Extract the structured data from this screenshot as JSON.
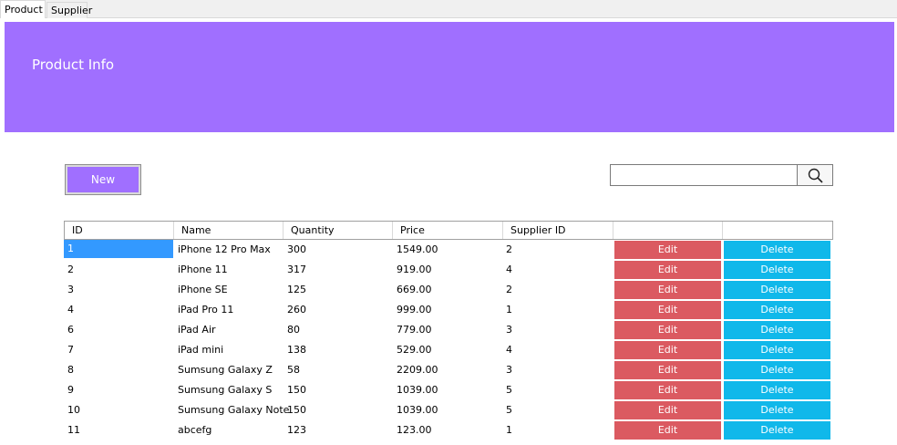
{
  "tabs": [
    {
      "label": "Product",
      "active": true
    },
    {
      "label": "Supplier",
      "active": false
    }
  ],
  "header": {
    "title": "Product Info",
    "color": "#a06fff"
  },
  "toolbar": {
    "new_label": "New",
    "search_value": ""
  },
  "table": {
    "columns": [
      "ID",
      "Name",
      "Quantity",
      "Price",
      "Supplier ID",
      "",
      ""
    ],
    "rows": [
      {
        "id": "1",
        "name": "iPhone 12 Pro Max",
        "quantity": "300",
        "price": "1549.00",
        "supplier_id": "2",
        "edit": "Edit",
        "delete": "Delete"
      },
      {
        "id": "2",
        "name": "iPhone 11",
        "quantity": "317",
        "price": "919.00",
        "supplier_id": "4",
        "edit": "Edit",
        "delete": "Delete"
      },
      {
        "id": "3",
        "name": "iPhone SE",
        "quantity": "125",
        "price": "669.00",
        "supplier_id": "2",
        "edit": "Edit",
        "delete": "Delete"
      },
      {
        "id": "4",
        "name": "iPad Pro 11",
        "quantity": "260",
        "price": "999.00",
        "supplier_id": "1",
        "edit": "Edit",
        "delete": "Delete"
      },
      {
        "id": "6",
        "name": "iPad Air",
        "quantity": "80",
        "price": "779.00",
        "supplier_id": "3",
        "edit": "Edit",
        "delete": "Delete"
      },
      {
        "id": "7",
        "name": "iPad mini",
        "quantity": "138",
        "price": "529.00",
        "supplier_id": "4",
        "edit": "Edit",
        "delete": "Delete"
      },
      {
        "id": "8",
        "name": "Sumsung Galaxy Z",
        "quantity": "58",
        "price": "2209.00",
        "supplier_id": "3",
        "edit": "Edit",
        "delete": "Delete"
      },
      {
        "id": "9",
        "name": "Sumsung Galaxy S",
        "quantity": "150",
        "price": "1039.00",
        "supplier_id": "5",
        "edit": "Edit",
        "delete": "Delete"
      },
      {
        "id": "10",
        "name": "Sumsung Galaxy Note",
        "quantity": "150",
        "price": "1039.00",
        "supplier_id": "5",
        "edit": "Edit",
        "delete": "Delete"
      },
      {
        "id": "11",
        "name": "abcefg",
        "quantity": "123",
        "price": "123.00",
        "supplier_id": "1",
        "edit": "Edit",
        "delete": "Delete"
      }
    ],
    "colors": {
      "edit": "#db5a61",
      "delete": "#10b8ea",
      "selection": "#3399ff"
    }
  }
}
